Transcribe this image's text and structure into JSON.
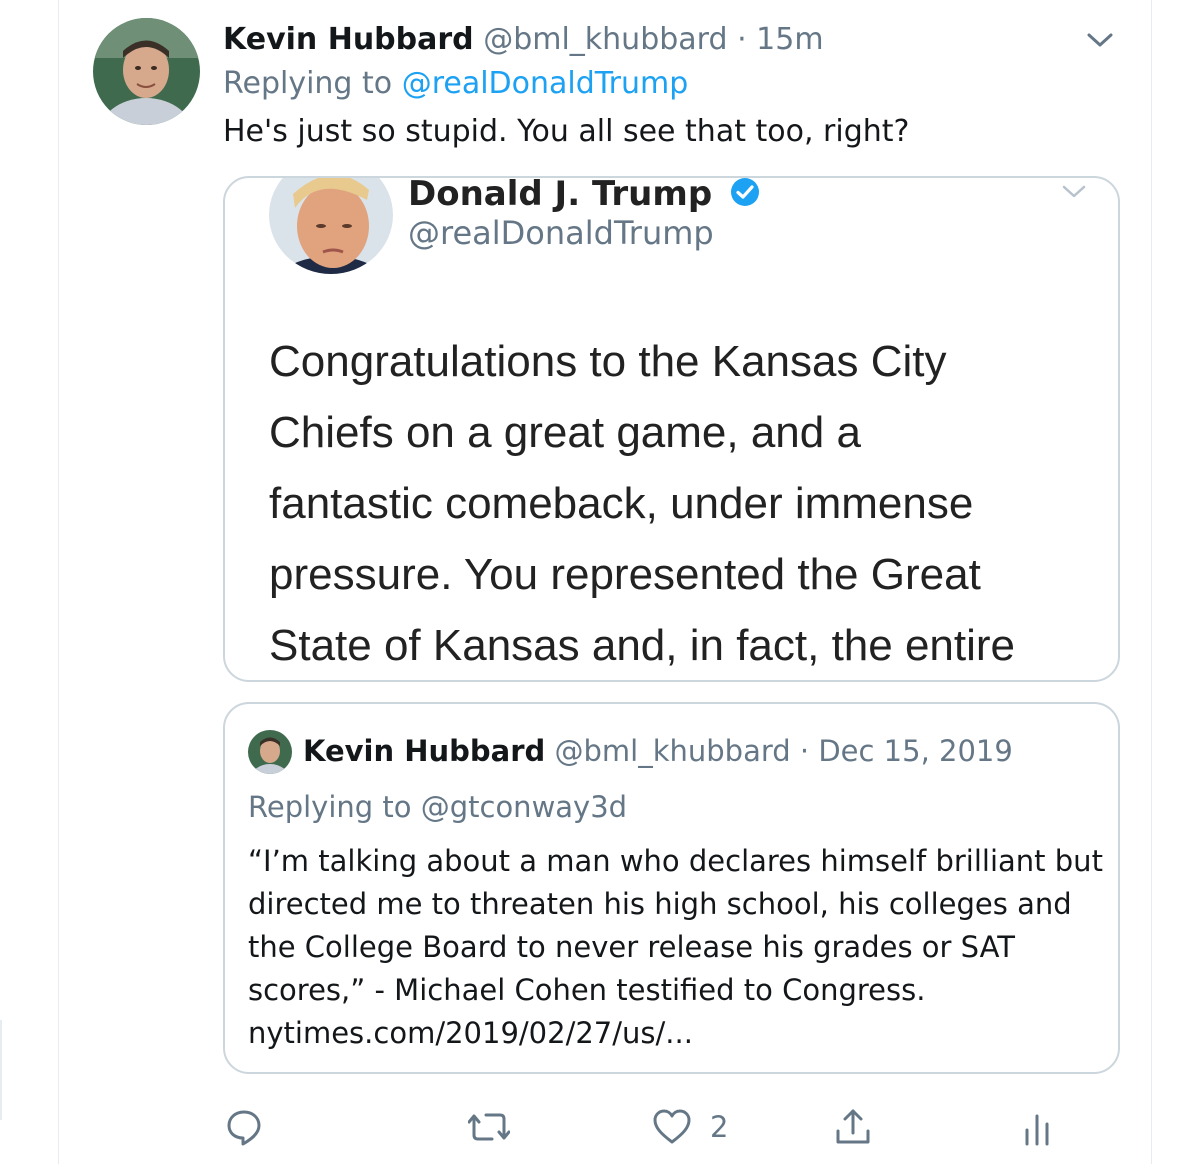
{
  "tweet": {
    "author_name": "Kevin Hubbard",
    "author_handle": "@bml_khubbard",
    "separator": "·",
    "time": "15m",
    "replying_prefix": "Replying to",
    "replying_to": "@realDonaldTrump",
    "text": "He's just so stupid. You all see that too, right?"
  },
  "image_card": {
    "name": "Donald J. Trump",
    "handle": "@realDonaldTrump",
    "text_lines": [
      "Congratulations to the Kansas City",
      "Chiefs on a great game, and a",
      "fantastic comeback, under immense",
      "pressure. You represented the Great",
      "State of Kansas and, in fact, the entire"
    ]
  },
  "quoted_tweet": {
    "author_name": "Kevin Hubbard",
    "author_handle": "@bml_khubbard",
    "separator": "·",
    "date": "Dec 15, 2019",
    "replying_prefix": "Replying to",
    "replying_to": "@gtconway3d",
    "text_lines": [
      "“I’m talking about a man who declares himself brilliant but",
      "directed me to threaten his high school, his colleges and",
      "the College Board to never release his grades or SAT",
      "scores,” - Michael  Cohen testified to Congress.",
      "nytimes.com/2019/02/27/us/..."
    ]
  },
  "actions": {
    "reply": {
      "icon": "reply-icon"
    },
    "retweet": {
      "icon": "retweet-icon"
    },
    "like": {
      "icon": "heart-icon",
      "count": "2"
    },
    "share": {
      "icon": "share-icon"
    },
    "analytics": {
      "icon": "analytics-icon"
    }
  },
  "colors": {
    "link": "#1da1f2",
    "muted": "#657786",
    "border": "#ccd6dd",
    "verified": "#1da1f2"
  }
}
